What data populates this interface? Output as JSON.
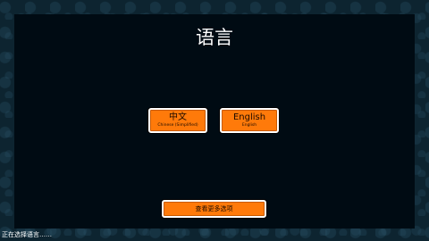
{
  "screen": {
    "title": "语言"
  },
  "language_options": [
    {
      "label": "中文",
      "sublabel": "Chinese (Simplified)"
    },
    {
      "label": "English",
      "sublabel": "English"
    }
  ],
  "more_options_label": "查看更多选项",
  "status_text": "正在选择语言……",
  "colors": {
    "button_fill": "#ff7a0a",
    "button_border": "#ffffff",
    "panel_bg": "#000b13",
    "page_bg": "#0d2430"
  }
}
